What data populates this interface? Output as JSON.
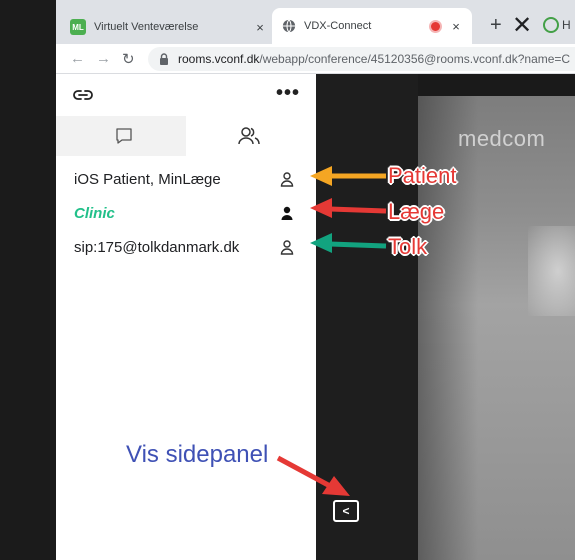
{
  "browser": {
    "tabs": [
      {
        "favicon": "ML",
        "title": "Virtuelt Venteværelse",
        "close": "×"
      },
      {
        "favicon": "globe-icon",
        "title": "VDX-Connect",
        "close": "×"
      }
    ],
    "new_tab": "+",
    "close_window": "✕",
    "partial_tab_letter": "H",
    "address": {
      "host": "rooms.vconf.dk",
      "path": "/webapp/conference/45120356@rooms.vconf.dk?name=C"
    }
  },
  "sidebar": {
    "more": "•••",
    "participants": [
      {
        "name": "iOS Patient, MinLæge",
        "style": "normal"
      },
      {
        "name": "Clinic",
        "style": "clinic"
      },
      {
        "name": "sip:175@tolkdanmark.dk",
        "style": "normal"
      }
    ]
  },
  "video": {
    "brand": "medcom"
  },
  "controls": {
    "show_panel": "<"
  },
  "annotations": {
    "patient": "Patient",
    "laege": "Læge",
    "tolk": "Tolk",
    "vis_sidepanel": "Vis sidepanel"
  },
  "colors": {
    "patient_arrow": "#f5a623",
    "laege_arrow": "#e53935",
    "tolk_arrow": "#12a37f",
    "vis_arrow": "#e53935",
    "clinic_text": "#22c08a",
    "annotation_text": "#e53935",
    "vis_text": "#3f51b5"
  }
}
